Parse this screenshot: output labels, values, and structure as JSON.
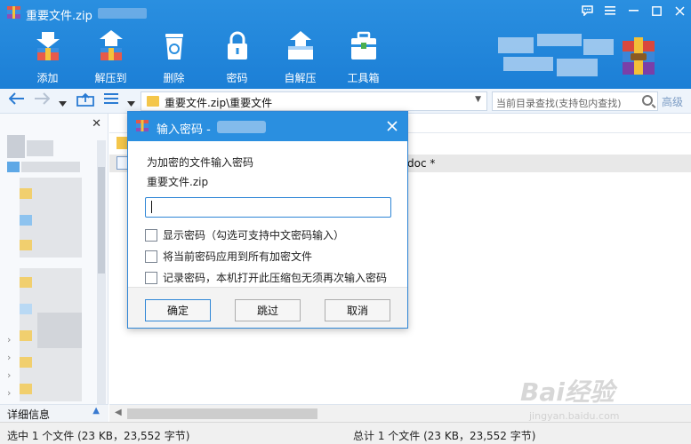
{
  "window": {
    "title": "重要文件.zip",
    "controls": [
      "comment-icon",
      "menu-icon",
      "minimize-icon",
      "maximize-icon",
      "close-icon"
    ]
  },
  "toolbar": {
    "items": [
      {
        "label": "添加",
        "icon": "add-icon"
      },
      {
        "label": "解压到",
        "icon": "extract-icon"
      },
      {
        "label": "删除",
        "icon": "delete-icon"
      },
      {
        "label": "密码",
        "icon": "lock-icon"
      },
      {
        "label": "自解压",
        "icon": "self-extract-icon"
      },
      {
        "label": "工具箱",
        "icon": "toolbox-icon"
      }
    ]
  },
  "addressbar": {
    "path": "重要文件.zip\\重要文件",
    "search_placeholder": "当前目录查找(支持包内查找)",
    "advanced_label": "高级"
  },
  "leftpane": {
    "detail_label": "详细信息"
  },
  "filelist": {
    "selected_file_suffix": "doc *"
  },
  "status": {
    "left": "选中 1 个文件 (23 KB，23,552 字节)",
    "right": "总计 1 个文件 (23 KB，23,552 字节)"
  },
  "watermark": {
    "brand": "Bai经验",
    "url": "jingyan.baidu.com"
  },
  "dialog": {
    "title": "输入密码 -",
    "prompt": "为加密的文件输入密码",
    "filename": "重要文件.zip",
    "password_value": "",
    "options": [
      {
        "label": "显示密码（勾选可支持中文密码输入）",
        "checked": false
      },
      {
        "label": "将当前密码应用到所有加密文件",
        "checked": false
      },
      {
        "label": "记录密码，本机打开此压缩包无须再次输入密码",
        "checked": false
      }
    ],
    "buttons": {
      "ok": "确定",
      "skip": "跳过",
      "cancel": "取消"
    }
  },
  "colors": {
    "titlebar_blue": "#2a8fe0",
    "accent_border": "#2f86d6"
  }
}
